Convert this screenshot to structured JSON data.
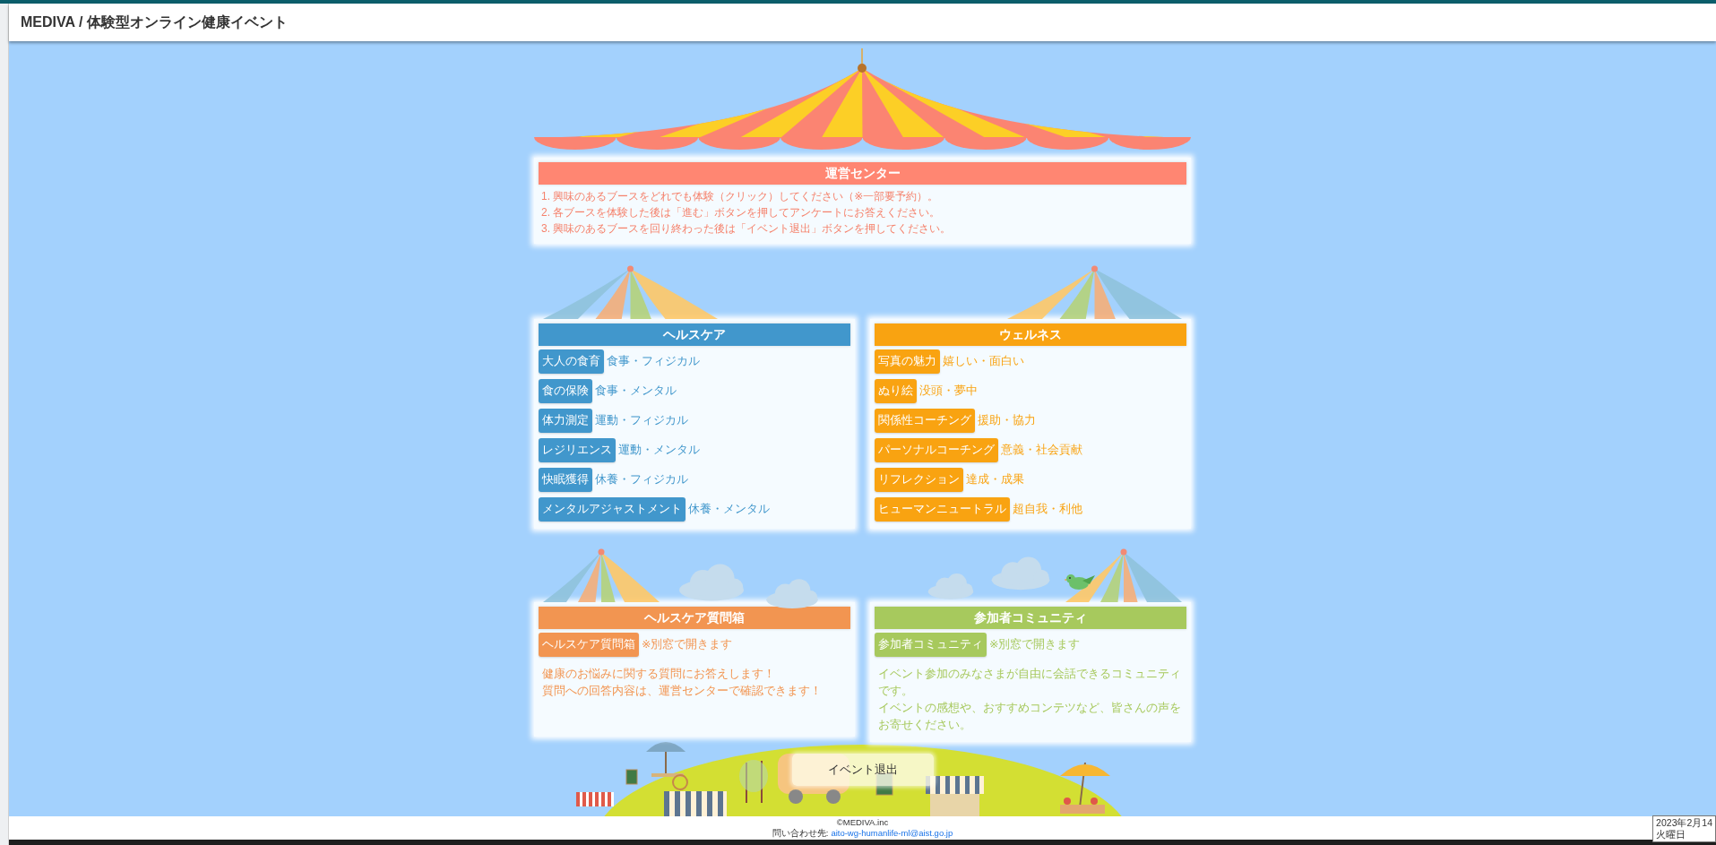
{
  "header": {
    "title": "MEDIVA / 体験型オンライン健康イベント"
  },
  "center": {
    "title": "運営センター",
    "instructions": [
      "1. 興味のあるブースをどれでも体験（クリック）してください（※一部要予約）。",
      "2. 各ブースを体験した後は「進む」ボタンを押してアンケートにお答えください。",
      "3. 興味のあるブースを回り終わった後は「イベント退出」ボタンを押してください。"
    ]
  },
  "booths": [
    {
      "title": "ヘルスケア",
      "kind": "list",
      "color": "#4197cc",
      "items": [
        {
          "label": "大人の食育",
          "tags": "食事・フィジカル"
        },
        {
          "label": "食の保険",
          "tags": "食事・メンタル"
        },
        {
          "label": "体力測定",
          "tags": "運動・フィジカル"
        },
        {
          "label": "レジリエンス",
          "tags": "運動・メンタル"
        },
        {
          "label": "快眠獲得",
          "tags": "休養・フィジカル"
        },
        {
          "label": "メンタルアジャストメント",
          "tags": "休養・メンタル"
        }
      ]
    },
    {
      "title": "ウェルネス",
      "kind": "list",
      "color": "#f9a311",
      "items": [
        {
          "label": "写真の魅力",
          "tags": "嬉しい・面白い"
        },
        {
          "label": "ぬり絵",
          "tags": "没頭・夢中"
        },
        {
          "label": "関係性コーチング",
          "tags": "援助・協力"
        },
        {
          "label": "パーソナルコーチング",
          "tags": "意義・社会貢献"
        },
        {
          "label": "リフレクション",
          "tags": "達成・成果"
        },
        {
          "label": "ヒューマンニュートラル",
          "tags": "超自我・利他"
        }
      ]
    },
    {
      "title": "ヘルスケア質問箱",
      "kind": "link",
      "color": "#f29551",
      "button": "ヘルスケア質問箱",
      "note": "※別窓で開きます",
      "description": [
        "健康のお悩みに関する質問にお答えします！",
        "質問への回答内容は、運営センターで確認できます！"
      ]
    },
    {
      "title": "参加者コミュニティ",
      "kind": "link",
      "color": "#a7c95d",
      "button": "参加者コミュニティ",
      "note": "※別窓で開きます",
      "description": [
        "イベント参加のみなさまが自由に会話できるコミュニティです。",
        "イベントの感想や、おすすめコンテツなど、皆さんの声をお寄せください。"
      ]
    }
  ],
  "exit_button": "イベント退出",
  "footer": {
    "copyright": "©MEDIVA.inc",
    "contact_label": "問い合わせ先:",
    "contact_link": "aito-wg-humanlife-ml@aist.go.jp"
  },
  "tooltip": {
    "lines": [
      "2023年2月14",
      "火曜日"
    ]
  }
}
